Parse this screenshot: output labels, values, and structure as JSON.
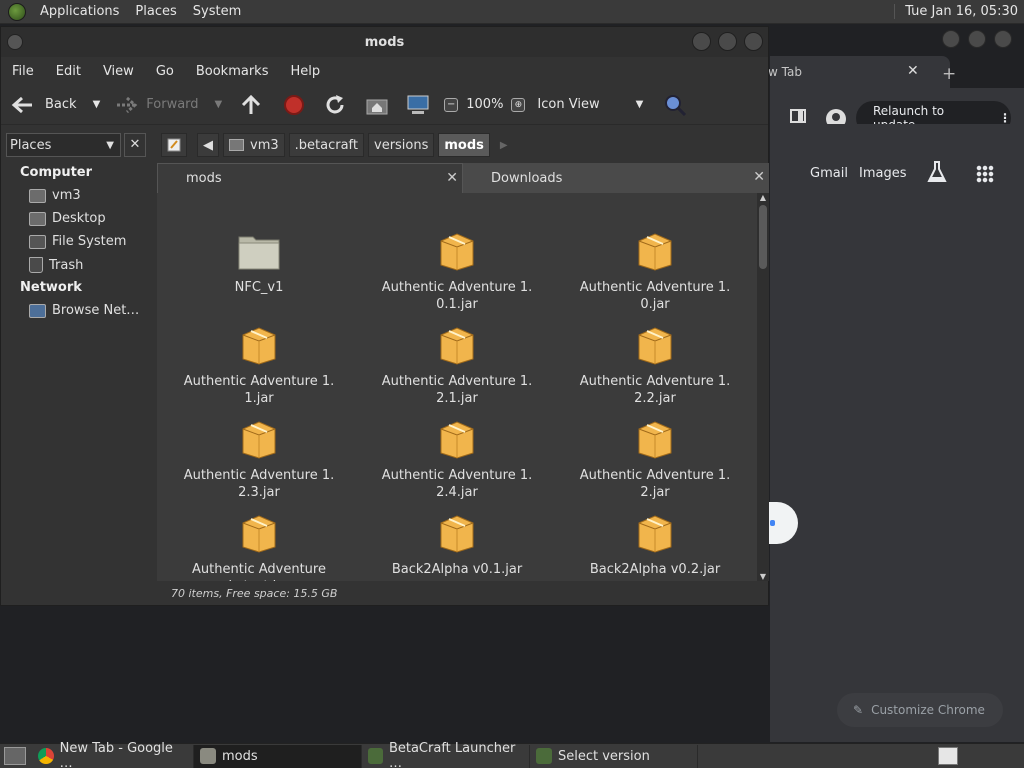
{
  "top_panel": {
    "menus": [
      "Applications",
      "Places",
      "System"
    ],
    "clock": "Tue Jan 16, 05:30"
  },
  "chrome": {
    "tab_title": "w Tab",
    "relaunch_label": "Relaunch to update",
    "links": {
      "gmail": "Gmail",
      "images": "Images"
    },
    "customize_label": "Customize Chrome"
  },
  "file_manager": {
    "title": "mods",
    "menubar": [
      "File",
      "Edit",
      "View",
      "Go",
      "Bookmarks",
      "Help"
    ],
    "toolbar": {
      "back": "Back",
      "forward": "Forward",
      "zoom": "100%",
      "view_mode": "Icon View"
    },
    "places_select": "Places",
    "sidebar": {
      "computer_header": "Computer",
      "computer_items": [
        "vm3",
        "Desktop",
        "File System",
        "Trash"
      ],
      "network_header": "Network",
      "network_items": [
        "Browse Net…"
      ]
    },
    "breadcrumbs": [
      "vm3",
      ".betacraft",
      "versions",
      "mods"
    ],
    "tabs": [
      "mods",
      "Downloads"
    ],
    "files": [
      {
        "line1": "NFC_v1",
        "line2": "",
        "type": "folder"
      },
      {
        "line1": "Authentic Adventure 1.",
        "line2": "0.1.jar",
        "type": "jar"
      },
      {
        "line1": "Authentic Adventure 1.",
        "line2": "0.jar",
        "type": "jar"
      },
      {
        "line1": "Authentic Adventure 1.",
        "line2": "1.jar",
        "type": "jar"
      },
      {
        "line1": "Authentic Adventure 1.",
        "line2": "2.1.jar",
        "type": "jar"
      },
      {
        "line1": "Authentic Adventure 1.",
        "line2": "2.2.jar",
        "type": "jar"
      },
      {
        "line1": "Authentic Adventure 1.",
        "line2": "2.3.jar",
        "type": "jar"
      },
      {
        "line1": "Authentic Adventure 1.",
        "line2": "2.4.jar",
        "type": "jar"
      },
      {
        "line1": "Authentic Adventure 1.",
        "line2": "2.jar",
        "type": "jar"
      },
      {
        "line1": "Authentic Adventure",
        "line2": "Latest.jar",
        "type": "jar"
      },
      {
        "line1": "Back2Alpha v0.1.jar",
        "line2": "",
        "type": "jar"
      },
      {
        "line1": "Back2Alpha v0.2.jar",
        "line2": "",
        "type": "jar"
      }
    ],
    "status": "70 items, Free space: 15.5 GB"
  },
  "taskbar": [
    {
      "label": "New Tab - Google …",
      "icon": "chrome-icon"
    },
    {
      "label": "mods",
      "icon": "folder-icon"
    },
    {
      "label": "BetaCraft Launcher …",
      "icon": "betacraft-icon"
    },
    {
      "label": "Select version",
      "icon": "betacraft-icon"
    }
  ]
}
